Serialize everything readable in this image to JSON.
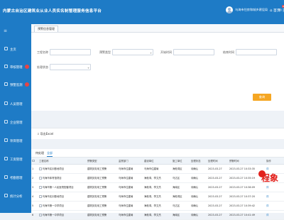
{
  "header": {
    "title": "内蒙古自治区建筑业从业人员实名制管理服务信息平台",
    "username": "乌海市住房和城乡建设局",
    "buttons": [
      {
        "label": "首页",
        "icon": "home-icon"
      },
      {
        "label": "提醒",
        "icon": "bell-icon",
        "badge": "0"
      },
      {
        "label": "退出",
        "icon": "exit-icon"
      }
    ]
  },
  "sidebar": {
    "items": [
      {
        "label": "主页",
        "icon": "home-icon",
        "badge": false
      },
      {
        "label": "审核管理",
        "icon": "audit-icon",
        "badge": true
      },
      {
        "label": "预警监测",
        "icon": "warning-icon",
        "badge": true
      },
      {
        "label": "人员管理",
        "icon": "people-icon",
        "badge": false
      },
      {
        "label": "企业管理",
        "icon": "company-icon",
        "badge": false
      },
      {
        "label": "项目管理",
        "icon": "project-icon",
        "badge": false
      },
      {
        "label": "工资管理",
        "icon": "wage-icon",
        "badge": false
      },
      {
        "label": "考勤管理",
        "icon": "attendance-icon",
        "badge": false
      },
      {
        "label": "统计分析",
        "icon": "stats-icon",
        "badge": false
      }
    ]
  },
  "tabs": [
    {
      "label": "预警信息管理"
    }
  ],
  "filters": [
    {
      "label": "工程名称",
      "value": ""
    },
    {
      "label": "预警类型",
      "value": ""
    },
    {
      "label": "开始时间",
      "value": ""
    },
    {
      "label": "结束时间",
      "value": ""
    },
    {
      "label": "处理状态",
      "value": ""
    }
  ],
  "query_label": "查询",
  "export_label": "导出Excel",
  "sub_tabs": [
    "待处理",
    "全部"
  ],
  "table": {
    "headers": [
      "",
      "工程名称",
      "预警类型",
      "监督部门",
      "建设单位",
      "施工单位",
      "处理状态",
      "处理时间",
      "预警时间",
      "操作"
    ],
    "rows": [
      [
        "1",
        "乌海市实训基地项目",
        "建筑劳务用工预警",
        "乌海市住建局",
        "乌海市住建局",
        "海勃湾区",
        "待确认",
        "2023-03-27",
        "2023-03-27 10:33:35",
        "详"
      ],
      [
        "2",
        "乌海市体育馆项目",
        "建筑劳务用工预警",
        "乌海市住建局",
        "海勃湾、李文杰",
        "乌达区",
        "待确认",
        "2023-03-27",
        "2023-03-27 10:35:19",
        "详"
      ],
      [
        "3",
        "乌海市第一人民医院配套项目",
        "建筑劳务用工预警",
        "乌海市住建局",
        "海勃湾、李文杰",
        "海南区",
        "待确认",
        "2023-03-27",
        "2023-03-27 10:36:09",
        "详"
      ],
      [
        "4",
        "乌海市实训基地项目",
        "建筑劳务用工预警",
        "乌海市住建局",
        "海勃湾、李文杰",
        "海勃湾区",
        "待确认",
        "2023-03-27",
        "2023-03-27 10:37:20",
        "详"
      ],
      [
        "5",
        "乌海市第一中学项目",
        "建筑劳务用工预警",
        "乌海市住建局",
        "海勃湾、李文杰",
        "乌达区",
        "待确认",
        "2023-03-27",
        "2023-03-27 10:39:42",
        "详"
      ],
      [
        "6",
        "乌海市第一中学项目",
        "建筑劳务用工预警",
        "乌海市住建局",
        "海勃湾、李文杰",
        "海南区",
        "待确认",
        "2023-03-27",
        "2023-03-27 10:41:49",
        "详"
      ]
    ]
  },
  "watermark": {
    "text": "程象"
  }
}
